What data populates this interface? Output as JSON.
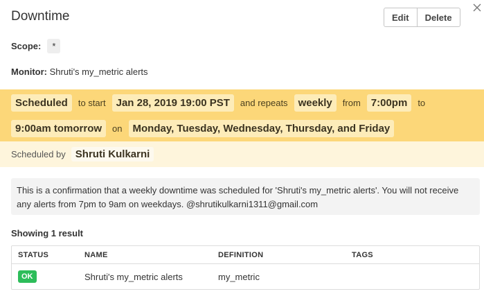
{
  "header": {
    "title": "Downtime",
    "edit_label": "Edit",
    "delete_label": "Delete"
  },
  "scope": {
    "label": "Scope:",
    "value": "*"
  },
  "monitor": {
    "label": "Monitor:",
    "value": "Shruti's my_metric alerts"
  },
  "schedule": {
    "status": "Scheduled",
    "to_start": "to start",
    "start_time": "Jan 28, 2019 19:00 PST",
    "and_repeats": "and repeats",
    "recurrence": "weekly",
    "from": "from",
    "from_time": "7:00pm",
    "to": "to",
    "to_time": "9:00am tomorrow",
    "on": "on",
    "days": "Monday, Tuesday, Wednesday, Thursday, and Friday"
  },
  "scheduled_by": {
    "label": "Scheduled by",
    "name": "Shruti Kulkarni"
  },
  "confirmation_message": "This is a confirmation that a weekly downtime was scheduled for 'Shruti's my_metric alerts'. You will not receive any alerts from 7pm to 9am on weekdays. @shrutikulkarni1311@gmail.com",
  "results": {
    "showing_label": "Showing 1 result",
    "columns": [
      "STATUS",
      "NAME",
      "DEFINITION",
      "TAGS"
    ],
    "rows": [
      {
        "status": "OK",
        "name": "Shruti's my_metric alerts",
        "definition": "my_metric",
        "tags": ""
      }
    ]
  },
  "colors": {
    "schedule_band": "#fcd779",
    "scheduled_by_band": "#fef5dc",
    "ok_badge": "#2dbd5a"
  }
}
